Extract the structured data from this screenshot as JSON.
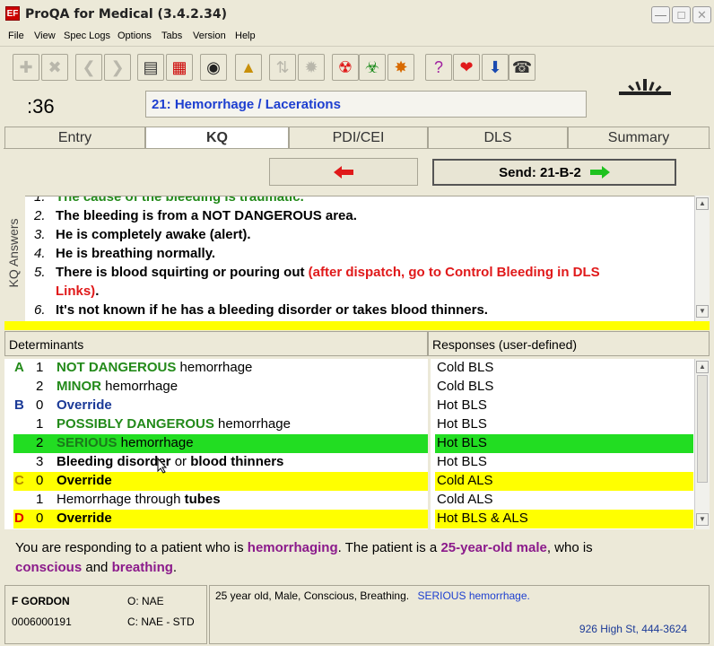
{
  "window": {
    "title": "ProQA for Medical (3.4.2.34)",
    "app_icon": "EF"
  },
  "menu": [
    "File",
    "View",
    "Spec Logs",
    "Options",
    "Tabs",
    "Version",
    "Help"
  ],
  "timer": ":36",
  "protocol": "21:  Hemorrhage / Lacerations",
  "tabs": [
    {
      "label": "Entry"
    },
    {
      "label": "KQ"
    },
    {
      "label": "PDI/CEI"
    },
    {
      "label": "DLS"
    },
    {
      "label": "Summary"
    }
  ],
  "active_tab": "KQ",
  "send": {
    "label": "Send: 21-B-2"
  },
  "kq_label": "KQ Answers",
  "kq_answers": [
    {
      "num": "1.",
      "text": "The cause of the bleeding is traumatic."
    },
    {
      "num": "2.",
      "text": "The bleeding is from a NOT DANGEROUS area."
    },
    {
      "num": "3.",
      "text": "He is completely awake (alert)."
    },
    {
      "num": "4.",
      "text": "He is breathing normally."
    },
    {
      "num": "5.",
      "text": "There is blood squirting or pouring out",
      "note": "(after dispatch, go to Control Bleeding in DLS",
      "note2": "Links)",
      "tail": "."
    },
    {
      "num": "6.",
      "text": "It's not known if he has a bleeding disorder or takes blood thinners."
    }
  ],
  "determinants_header": "Determinants",
  "responses_header": "Responses (user-defined)",
  "determinants": [
    {
      "level": "A",
      "num": "1",
      "bold": "NOT DANGEROUS",
      "rest": " hemorrhage",
      "response": "Cold BLS"
    },
    {
      "level": "",
      "num": "2",
      "bold": "MINOR",
      "rest": " hemorrhage",
      "response": "Cold BLS"
    },
    {
      "level": "B",
      "num": "0",
      "bold": "Override",
      "rest": "",
      "response": "Hot BLS"
    },
    {
      "level": "",
      "num": "1",
      "bold": "POSSIBLY DANGEROUS",
      "rest": " hemorrhage",
      "response": "Hot BLS"
    },
    {
      "level": "",
      "num": "2",
      "bold": "SERIOUS",
      "rest": " hemorrhage",
      "response": "Hot BLS"
    },
    {
      "level": "",
      "num": "3",
      "bold": "Bleeding disorder",
      "mid": " or ",
      "bold2": "blood thinners",
      "rest": "",
      "response": "Hot BLS"
    },
    {
      "level": "C",
      "num": "0",
      "bold": "Override",
      "rest": "",
      "response": "Cold ALS"
    },
    {
      "level": "",
      "num": "1",
      "pre": "Hemorrhage through ",
      "bold": "tubes",
      "rest": "",
      "response": "Cold ALS"
    },
    {
      "level": "D",
      "num": "0",
      "bold": "Override",
      "rest": "",
      "response": "Hot BLS & ALS"
    }
  ],
  "narrative": {
    "t1": "You are responding to a patient who is ",
    "b1": "hemorrhaging",
    "t2": ".  The patient is a ",
    "b2": "25-year-old male",
    "t3": ", who is",
    "b3": "conscious",
    "t4": " and ",
    "b4": "breathing",
    "t5": "."
  },
  "status": {
    "user": "F GORDON",
    "case_num": "0006000191",
    "o_label": "O: NAE",
    "c_label": "C: NAE - STD",
    "summary": "25 year old, Male, Conscious, Breathing.",
    "summary_det": "SERIOUS hemorrhage.",
    "address": "926 High St,  444-3624"
  },
  "colors": {
    "highlight_green": "#22dd22",
    "highlight_yellow": "#ffff00",
    "protocol_blue": "#1d3fd0"
  }
}
